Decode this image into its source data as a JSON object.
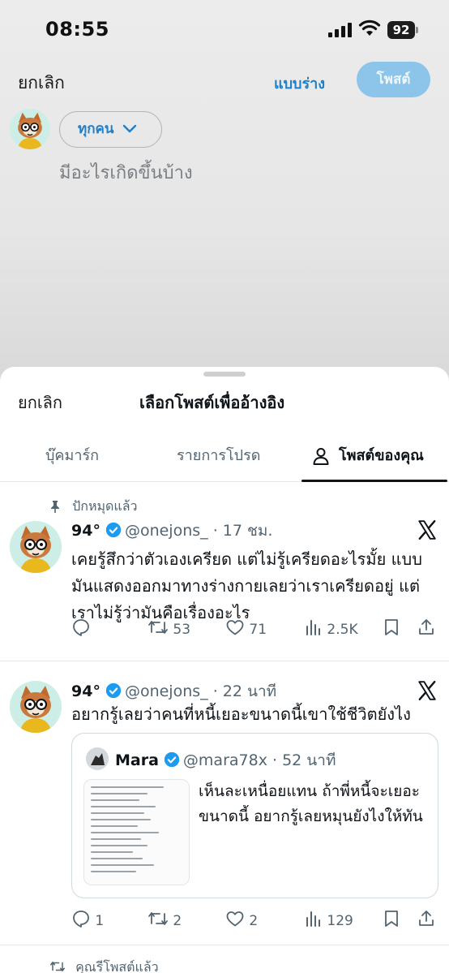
{
  "status_bar": {
    "time": "08:55",
    "battery": "92"
  },
  "compose": {
    "cancel_label": "ยกเลิก",
    "draft_label": "แบบร่าง",
    "post_label": "โพสต์",
    "audience_label": "ทุกคน",
    "placeholder": "มีอะไรเกิดขึ้นบ้าง"
  },
  "sheet": {
    "cancel_label": "ยกเลิก",
    "title": "เลือกโพสต์เพื่ออ้างอิง",
    "tabs": [
      {
        "label": "บุ๊คมาร์ก"
      },
      {
        "label": "รายการโปรด"
      },
      {
        "label": "โพสต์ของคุณ",
        "active": true
      }
    ]
  },
  "posts": [
    {
      "context": "ปักหมุดแล้ว",
      "name": "94°",
      "handle": "@onejons_",
      "time": "· 17 ชม.",
      "text": "เคยรู้สึกว่าตัวเองเครียด แต่ไม่รู้เครียดอะไรมั้ย แบบมันแสดงออกมาทางร่างกายเลยว่าเราเครียดอยู่ แต่เราไม่รู้ว่ามันคือเรื่องอะไร",
      "replies": "",
      "reposts": "53",
      "likes": "71",
      "views": "2.5K"
    },
    {
      "name": "94°",
      "handle": "@onejons_",
      "time": "· 22 นาที",
      "text": "อยากรู้เลยว่าคนที่หนี้เยอะขนาดนี้เขาใช้ชีวิตยังไง",
      "quote": {
        "name": "Mara",
        "handle": "@mara78x",
        "time": "· 52 นาที",
        "text": "เห็นละเหนื่อยแทน ถ้าพี่หนี้จะเยอะขนาดนี้ อยากรู้เลยหมุนยังไงให้ทัน"
      },
      "replies": "1",
      "reposts": "2",
      "likes": "2",
      "views": "129"
    }
  ],
  "reposted_label": "คุณรีโพสต์แล้ว",
  "colors": {
    "accent": "#1d9bf0",
    "post_button_disabled": "#8cc4ea",
    "muted": "#536471"
  }
}
